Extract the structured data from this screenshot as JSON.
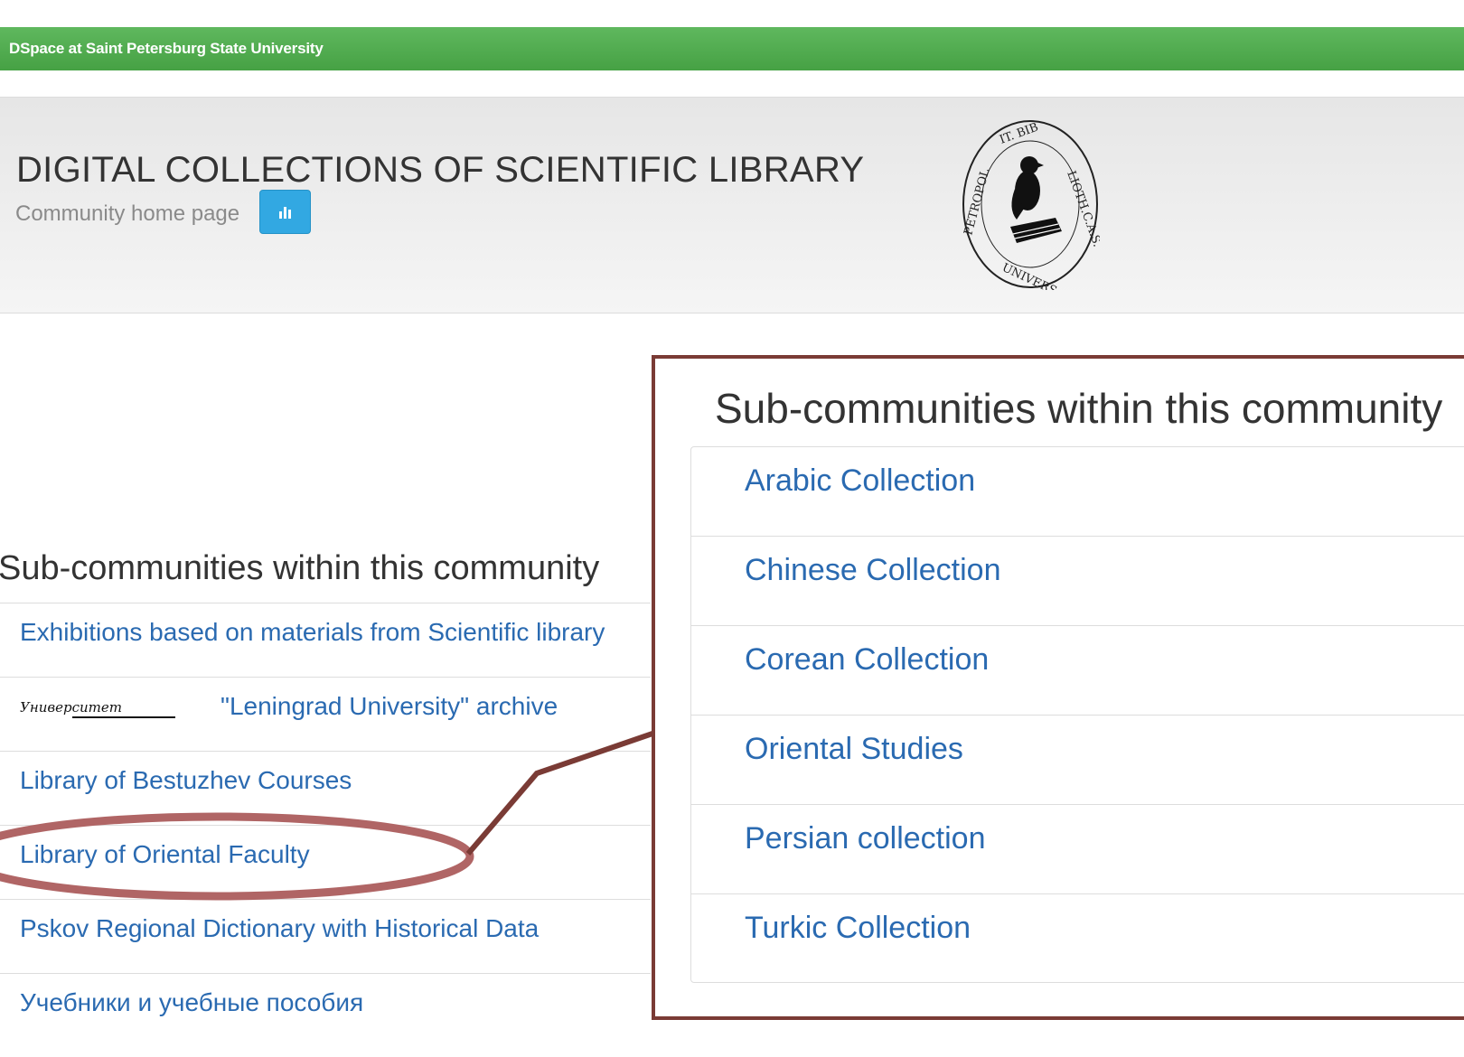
{
  "navbar": {
    "brand": "DSpace at Saint Petersburg State University"
  },
  "header": {
    "title": "DIGITAL COLLECTIONS OF SCIENTIFIC LIBRARY",
    "subtitle": "Community home page",
    "stats_icon": "bar-chart-icon",
    "seal_text": "PETROPOLIT. BIBLIOTH. C.A.S. UNIVERS."
  },
  "left": {
    "heading": "Sub-communities within this community",
    "items": [
      {
        "label": "Exhibitions based on materials from Scientific library"
      },
      {
        "label": "\"Leningrad University\" archive",
        "thumb_text": "Университет"
      },
      {
        "label": "Library of Bestuzhev Courses"
      },
      {
        "label": "Library of Oriental Faculty",
        "highlighted": true
      },
      {
        "label": "Pskov Regional Dictionary with Historical Data"
      },
      {
        "label": "Учебники и учебные пособия"
      }
    ]
  },
  "callout": {
    "heading": "Sub-communities within this community",
    "items": [
      {
        "label": "Arabic Collection"
      },
      {
        "label": "Chinese Collection"
      },
      {
        "label": "Corean Collection"
      },
      {
        "label": "Oriental Studies"
      },
      {
        "label": "Persian collection"
      },
      {
        "label": "Turkic Collection"
      }
    ]
  },
  "colors": {
    "navbar": "#4ea84c",
    "link": "#2a6ab1",
    "callout_border": "#7a3b35",
    "highlight_ellipse": "#b06565",
    "stats_button": "#32a8e2"
  }
}
